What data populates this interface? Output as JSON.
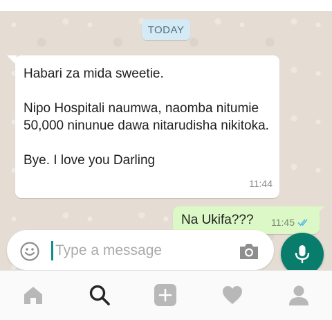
{
  "chat": {
    "date_chip": "TODAY",
    "messages": [
      {
        "direction": "incoming",
        "text": "Habari za mida sweetie.\n\nNipo Hospitali naumwa, naomba nitumie 50,000 ninunue dawa nitarudisha nikitoka.\n\nBye. I love you Darling",
        "time": "11:44"
      },
      {
        "direction": "outgoing",
        "text": "Na Ukifa???",
        "time": "11:45",
        "status_icon": "double-check-icon"
      }
    ]
  },
  "composer": {
    "placeholder": "Type a message",
    "value": "",
    "left_icon": "emoji-icon",
    "attach_icon": "camera-icon",
    "action_icon": "microphone-icon"
  },
  "bottom_nav": {
    "items": [
      "home-icon",
      "search-icon",
      "add-icon",
      "heart-icon",
      "profile-icon"
    ],
    "active": "search-icon"
  },
  "colors": {
    "chat_background": "#e5ddd4",
    "incoming_bubble": "#ffffff",
    "outgoing_bubble": "#dcf8c6",
    "date_chip": "#d4eaf4",
    "accent": "#087d6c",
    "read_tick": "#4fb6ec"
  }
}
